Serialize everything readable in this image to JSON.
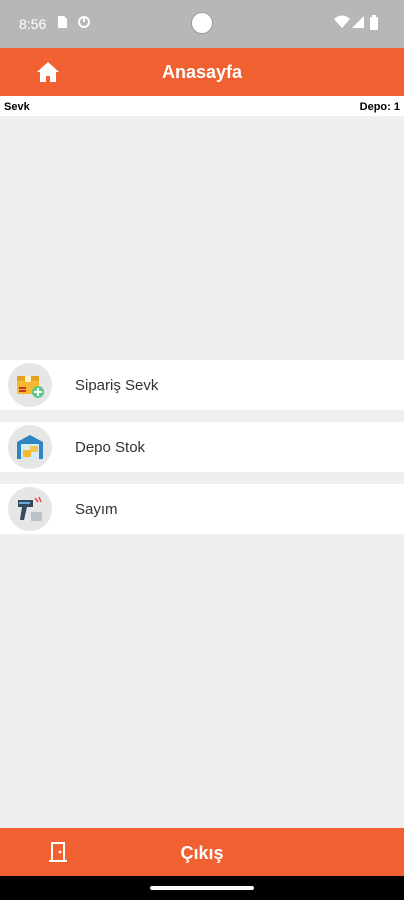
{
  "status_bar": {
    "time": "8:56",
    "icons": [
      "sim-card-icon",
      "sync-icon",
      "wifi-icon",
      "signal-icon",
      "battery-icon"
    ]
  },
  "app_bar": {
    "title": "Anasayfa",
    "home_icon": "home-icon",
    "color": "#f06030"
  },
  "info_strip": {
    "left": "Sevk",
    "right": "Depo: 1"
  },
  "menu": {
    "items": [
      {
        "label": "Sipariş Sevk",
        "icon": "package-delivery-icon"
      },
      {
        "label": "Depo Stok",
        "icon": "warehouse-icon"
      },
      {
        "label": "Sayım",
        "icon": "barcode-scanner-icon"
      }
    ]
  },
  "bottom_bar": {
    "label": "Çıkış",
    "icon": "door-exit-icon"
  }
}
